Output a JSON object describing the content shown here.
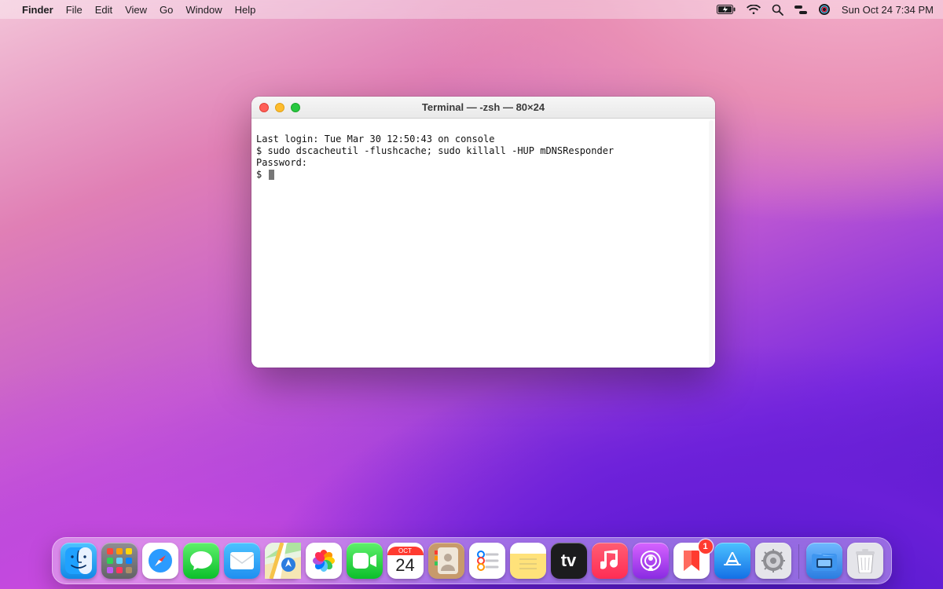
{
  "menu": {
    "app": "Finder",
    "items": [
      "File",
      "Edit",
      "View",
      "Go",
      "Window",
      "Help"
    ],
    "clock": "Sun Oct 24  7:34 PM"
  },
  "status_icons": [
    "battery-charging-icon",
    "wifi-icon",
    "spotlight-icon",
    "control-center-icon",
    "siri-icon"
  ],
  "terminal": {
    "title": "Terminal — -zsh — 80×24",
    "lines": [
      "Last login: Tue Mar 30 12:50:43 on console",
      "$ sudo dscacheutil -flushcache; sudo killall -HUP mDNSResponder",
      "Password:",
      "$ "
    ]
  },
  "calendar": {
    "month": "OCT",
    "day": "24"
  },
  "dock": {
    "apps": [
      {
        "name": "finder",
        "label": "Finder"
      },
      {
        "name": "launchpad",
        "label": "Launchpad"
      },
      {
        "name": "safari",
        "label": "Safari"
      },
      {
        "name": "messages",
        "label": "Messages"
      },
      {
        "name": "mail",
        "label": "Mail"
      },
      {
        "name": "maps",
        "label": "Maps"
      },
      {
        "name": "photos",
        "label": "Photos"
      },
      {
        "name": "facetime",
        "label": "FaceTime"
      },
      {
        "name": "calendar",
        "label": "Calendar"
      },
      {
        "name": "contacts",
        "label": "Contacts"
      },
      {
        "name": "reminders",
        "label": "Reminders"
      },
      {
        "name": "notes",
        "label": "Notes"
      },
      {
        "name": "tv",
        "label": "TV"
      },
      {
        "name": "music",
        "label": "Music"
      },
      {
        "name": "podcasts",
        "label": "Podcasts"
      },
      {
        "name": "news",
        "label": "News"
      },
      {
        "name": "appstore",
        "label": "App Store"
      },
      {
        "name": "settings",
        "label": "System Preferences"
      }
    ],
    "news_badge": "1",
    "tv_label": "tv",
    "right": [
      {
        "name": "downloads",
        "label": "Downloads"
      },
      {
        "name": "trash",
        "label": "Trash"
      }
    ]
  }
}
